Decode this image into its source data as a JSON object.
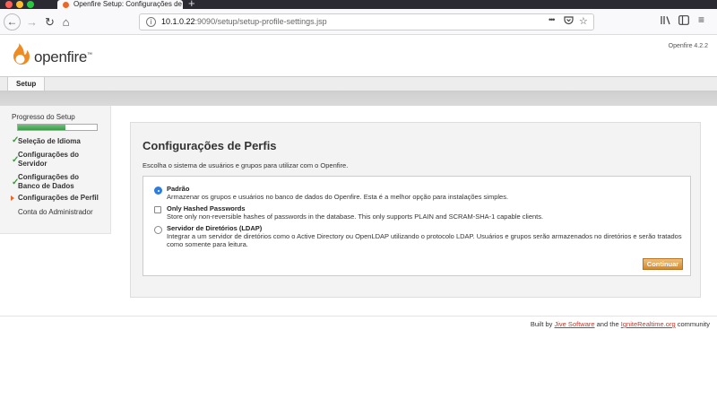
{
  "browser": {
    "tab_title": "Openfire Setup: Configurações de Perfis",
    "url_host": "10.1.0.22",
    "url_rest": ":9090/setup/setup-profile-settings.jsp",
    "url_actions_icon": "•••",
    "new_tab_icon": "+"
  },
  "header": {
    "logo_text": "openfire",
    "logo_tm": "™",
    "version": "Openfire 4.2.2"
  },
  "tabs": {
    "setup": "Setup"
  },
  "sidebar": {
    "progress_label": "Progresso do Setup",
    "progress_fraction": 0.6,
    "items": [
      {
        "label": "Seleção de Idioma",
        "state": "done"
      },
      {
        "label": "Configurações do Servidor",
        "state": "done"
      },
      {
        "label": "Configurações do Banco de Dados",
        "state": "done"
      },
      {
        "label": "Configurações de Perfil",
        "state": "current"
      },
      {
        "label": "Conta do Administrador",
        "state": "pending"
      }
    ]
  },
  "main": {
    "title": "Configurações de Perfis",
    "description": "Escolha o sistema de usuários e grupos para utilizar com o Openfire.",
    "options": [
      {
        "title": "Padrão",
        "description": "Armazenar os grupos e usuários no banco de dados do Openfire. Esta é a melhor opção para instalações simples.",
        "control": "radio",
        "selected": true
      },
      {
        "title": "Only Hashed Passwords",
        "description": "Store only non-reversible hashes of passwords in the database. This only supports PLAIN and SCRAM-SHA-1 capable clients.",
        "control": "checkbox",
        "selected": false
      },
      {
        "title": "Servidor de Diretórios (LDAP)",
        "description": "Integrar a um servidor de diretórios como o Active Directory ou OpenLDAP utilizando o protocolo LDAP. Usuários e grupos serão armazenados no diretórios e serão tratados como somente para leitura.",
        "control": "radio",
        "selected": false
      }
    ],
    "continue_label": "Continuar"
  },
  "footer": {
    "prefix": "Built by",
    "link1": "Jive Software",
    "middle": "and the",
    "link2": "IgniteRealtime.org",
    "suffix": "community"
  },
  "colors": {
    "accent_orange": "#e8682b",
    "progress_green": "#3d9a49",
    "button_gold": "#d4892d",
    "link_red": "#c0392b"
  }
}
